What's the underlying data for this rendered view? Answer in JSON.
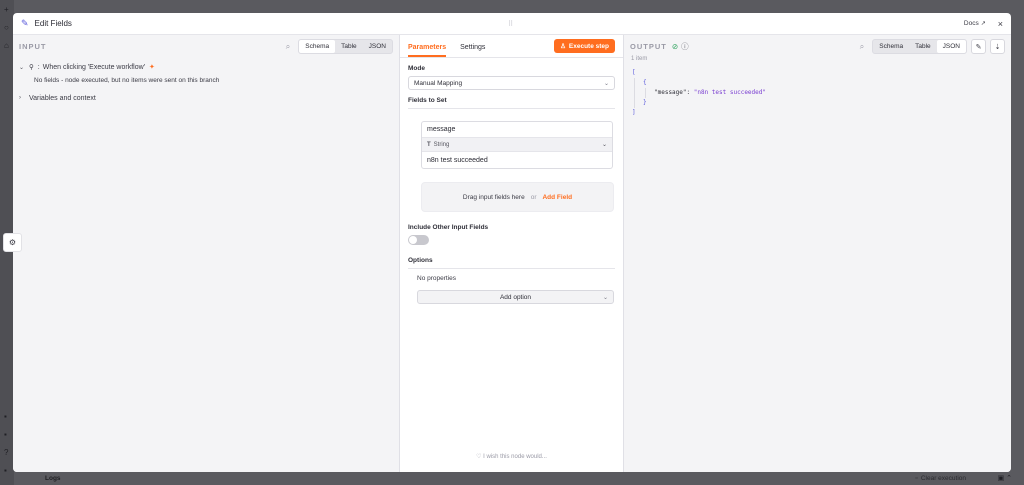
{
  "modal": {
    "title": "Edit Fields",
    "docs_label": "Docs",
    "close_label": "×"
  },
  "input": {
    "title": "INPUT",
    "views": [
      "Schema",
      "Table",
      "JSON"
    ],
    "active_view": "Schema",
    "trigger_label": "When clicking 'Execute workflow'",
    "no_fields_msg": "No fields - node executed, but no items were sent on this branch",
    "vars_label": "Variables and context"
  },
  "params": {
    "tabs": [
      "Parameters",
      "Settings"
    ],
    "active_tab": "Parameters",
    "execute_label": "Execute step",
    "mode_label": "Mode",
    "mode_value": "Manual Mapping",
    "fields_label": "Fields to Set",
    "field": {
      "name": "message",
      "type": "String",
      "value": "n8n test succeeded"
    },
    "drop_text": "Drag input fields here",
    "drop_or": "or",
    "add_field_label": "Add Field",
    "include_label": "Include Other Input Fields",
    "include_on": false,
    "options_label": "Options",
    "no_properties": "No properties",
    "add_option_label": "Add option",
    "wish_text": "I wish this node would..."
  },
  "output": {
    "title": "OUTPUT",
    "items_count": "1 item",
    "views": [
      "Schema",
      "Table",
      "JSON"
    ],
    "active_view": "JSON",
    "json": {
      "open_bracket": "[",
      "open_brace": "{",
      "key": "\"message\":",
      "value": "\"n8n test succeeded\"",
      "close_brace": "}",
      "close_bracket": "]"
    }
  },
  "background": {
    "logs_label": "Logs",
    "clear_label": "Clear execution"
  },
  "colors": {
    "accent": "#ff6d1f",
    "success": "#2aa15a",
    "json_string": "#7a3fd1"
  }
}
